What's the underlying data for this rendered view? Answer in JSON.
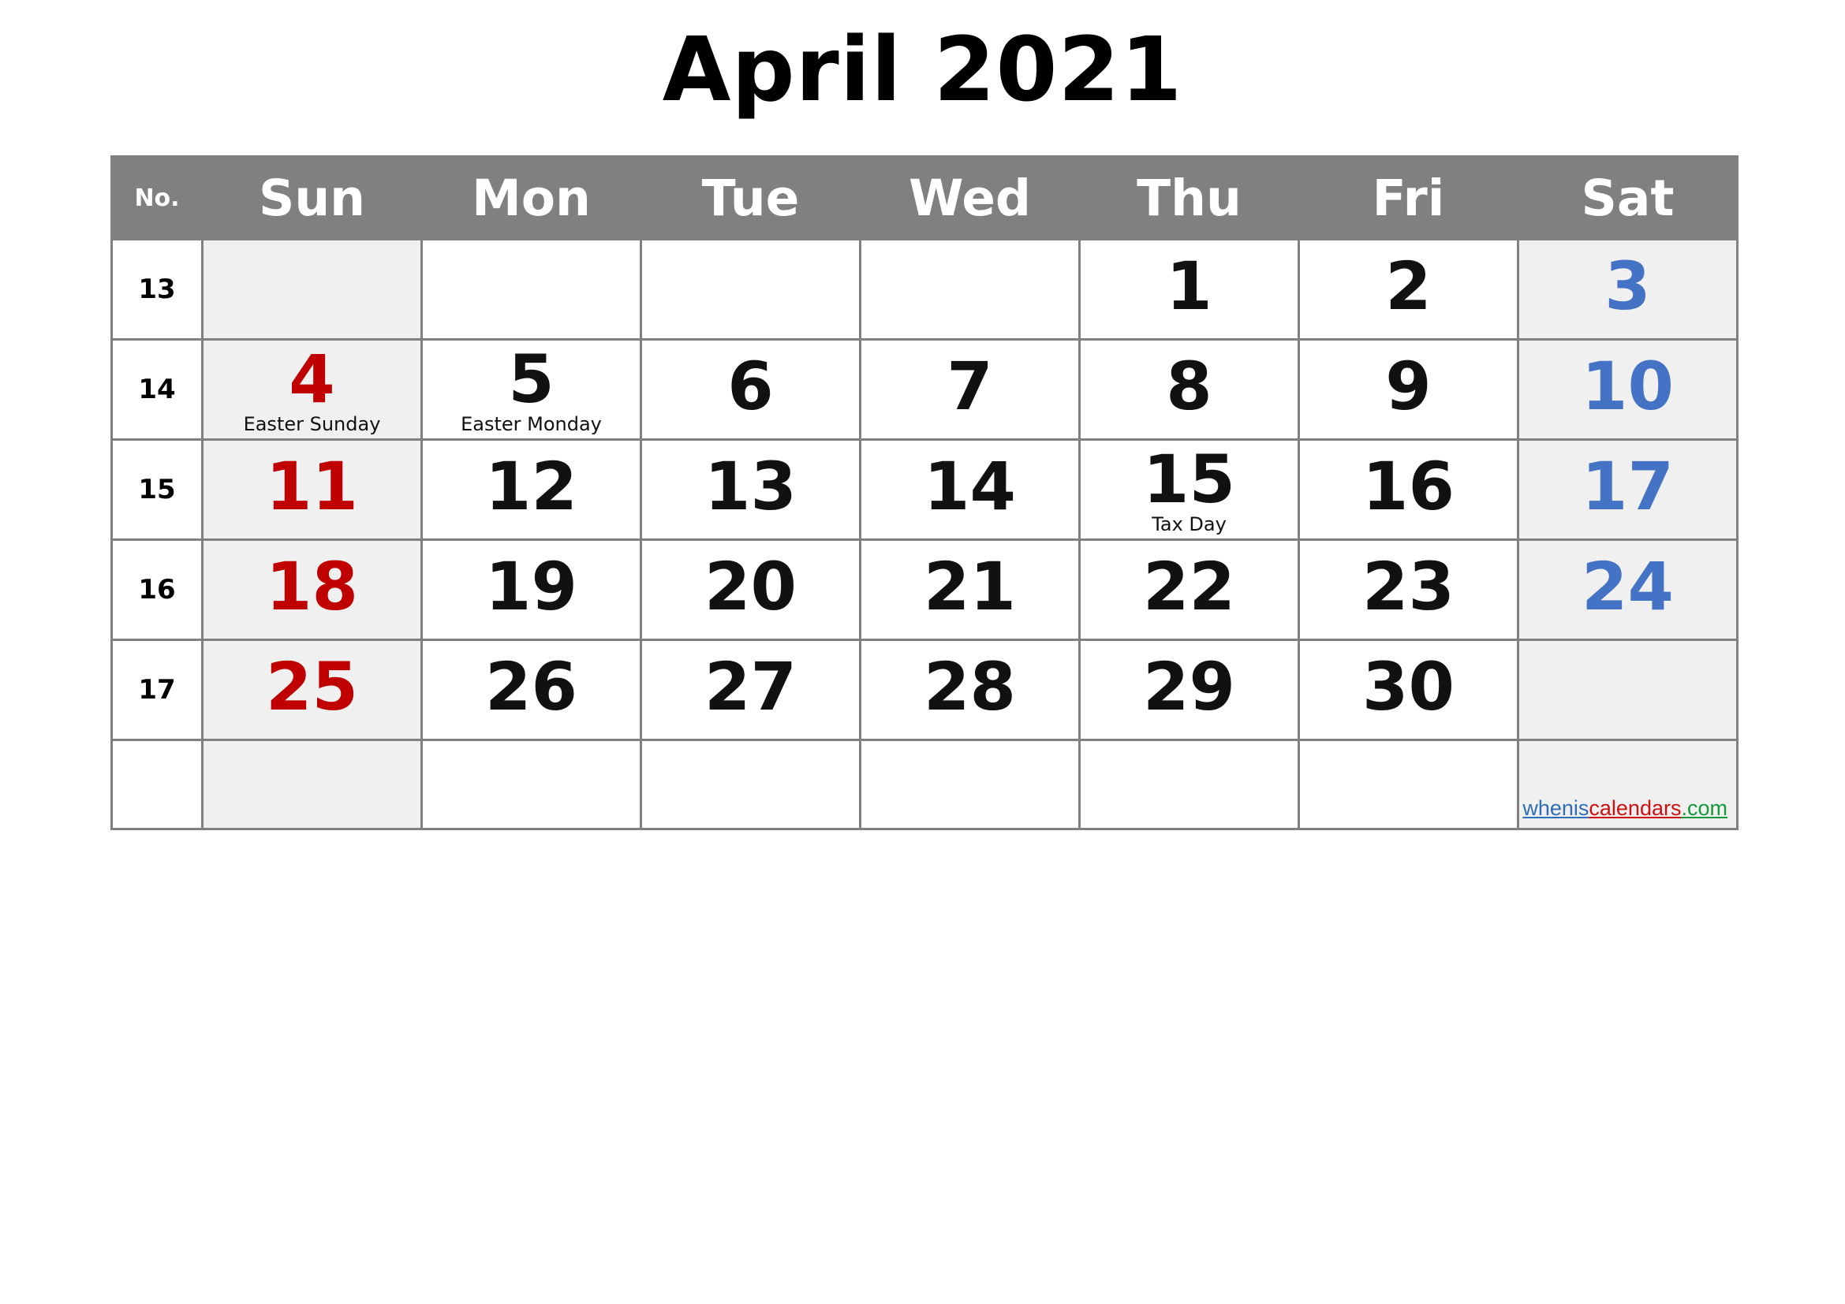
{
  "title": "April 2021",
  "header": {
    "week_number_label": "No.",
    "days": [
      "Sun",
      "Mon",
      "Tue",
      "Wed",
      "Thu",
      "Fri",
      "Sat"
    ]
  },
  "colors": {
    "header_background": "#808080",
    "header_text": "#ffffff",
    "grid_border": "#808080",
    "weekend_cell_background": "#f0f0f0",
    "sunday_date": "#c00000",
    "saturday_date": "#4472c4",
    "weekday_date": "#111111"
  },
  "weeks": [
    {
      "number": "13",
      "days": [
        {
          "date": "",
          "holiday": ""
        },
        {
          "date": "",
          "holiday": ""
        },
        {
          "date": "",
          "holiday": ""
        },
        {
          "date": "",
          "holiday": ""
        },
        {
          "date": "1",
          "holiday": ""
        },
        {
          "date": "2",
          "holiday": ""
        },
        {
          "date": "3",
          "holiday": ""
        }
      ]
    },
    {
      "number": "14",
      "days": [
        {
          "date": "4",
          "holiday": "Easter Sunday"
        },
        {
          "date": "5",
          "holiday": "Easter Monday"
        },
        {
          "date": "6",
          "holiday": ""
        },
        {
          "date": "7",
          "holiday": ""
        },
        {
          "date": "8",
          "holiday": ""
        },
        {
          "date": "9",
          "holiday": ""
        },
        {
          "date": "10",
          "holiday": ""
        }
      ]
    },
    {
      "number": "15",
      "days": [
        {
          "date": "11",
          "holiday": ""
        },
        {
          "date": "12",
          "holiday": ""
        },
        {
          "date": "13",
          "holiday": ""
        },
        {
          "date": "14",
          "holiday": ""
        },
        {
          "date": "15",
          "holiday": "Tax Day"
        },
        {
          "date": "16",
          "holiday": ""
        },
        {
          "date": "17",
          "holiday": ""
        }
      ]
    },
    {
      "number": "16",
      "days": [
        {
          "date": "18",
          "holiday": ""
        },
        {
          "date": "19",
          "holiday": ""
        },
        {
          "date": "20",
          "holiday": ""
        },
        {
          "date": "21",
          "holiday": ""
        },
        {
          "date": "22",
          "holiday": ""
        },
        {
          "date": "23",
          "holiday": ""
        },
        {
          "date": "24",
          "holiday": ""
        }
      ]
    },
    {
      "number": "17",
      "days": [
        {
          "date": "25",
          "holiday": ""
        },
        {
          "date": "26",
          "holiday": ""
        },
        {
          "date": "27",
          "holiday": ""
        },
        {
          "date": "28",
          "holiday": ""
        },
        {
          "date": "29",
          "holiday": ""
        },
        {
          "date": "30",
          "holiday": ""
        },
        {
          "date": "",
          "holiday": ""
        }
      ]
    },
    {
      "number": "",
      "days": [
        {
          "date": "",
          "holiday": ""
        },
        {
          "date": "",
          "holiday": ""
        },
        {
          "date": "",
          "holiday": ""
        },
        {
          "date": "",
          "holiday": ""
        },
        {
          "date": "",
          "holiday": ""
        },
        {
          "date": "",
          "holiday": ""
        },
        {
          "date": "",
          "holiday": ""
        }
      ]
    }
  ],
  "watermark": {
    "part1": "whenis",
    "part2": "calendars",
    "part3": ".com"
  }
}
